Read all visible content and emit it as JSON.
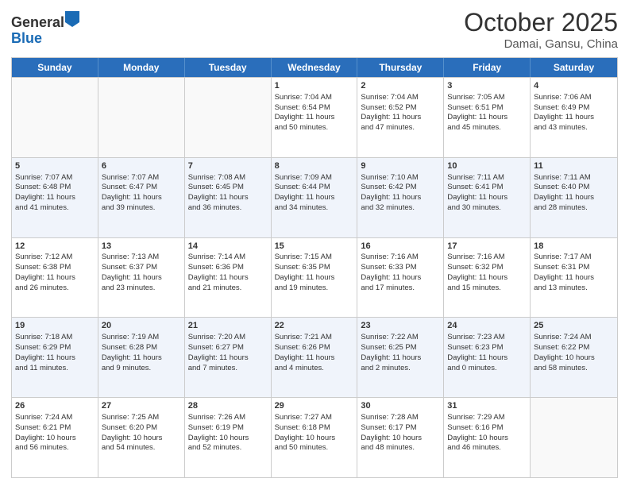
{
  "logo": {
    "general": "General",
    "blue": "Blue"
  },
  "title": "October 2025",
  "location": "Damai, Gansu, China",
  "days": [
    "Sunday",
    "Monday",
    "Tuesday",
    "Wednesday",
    "Thursday",
    "Friday",
    "Saturday"
  ],
  "weeks": [
    [
      {
        "day": "",
        "info": ""
      },
      {
        "day": "",
        "info": ""
      },
      {
        "day": "",
        "info": ""
      },
      {
        "day": "1",
        "info": "Sunrise: 7:04 AM\nSunset: 6:54 PM\nDaylight: 11 hours\nand 50 minutes."
      },
      {
        "day": "2",
        "info": "Sunrise: 7:04 AM\nSunset: 6:52 PM\nDaylight: 11 hours\nand 47 minutes."
      },
      {
        "day": "3",
        "info": "Sunrise: 7:05 AM\nSunset: 6:51 PM\nDaylight: 11 hours\nand 45 minutes."
      },
      {
        "day": "4",
        "info": "Sunrise: 7:06 AM\nSunset: 6:49 PM\nDaylight: 11 hours\nand 43 minutes."
      }
    ],
    [
      {
        "day": "5",
        "info": "Sunrise: 7:07 AM\nSunset: 6:48 PM\nDaylight: 11 hours\nand 41 minutes."
      },
      {
        "day": "6",
        "info": "Sunrise: 7:07 AM\nSunset: 6:47 PM\nDaylight: 11 hours\nand 39 minutes."
      },
      {
        "day": "7",
        "info": "Sunrise: 7:08 AM\nSunset: 6:45 PM\nDaylight: 11 hours\nand 36 minutes."
      },
      {
        "day": "8",
        "info": "Sunrise: 7:09 AM\nSunset: 6:44 PM\nDaylight: 11 hours\nand 34 minutes."
      },
      {
        "day": "9",
        "info": "Sunrise: 7:10 AM\nSunset: 6:42 PM\nDaylight: 11 hours\nand 32 minutes."
      },
      {
        "day": "10",
        "info": "Sunrise: 7:11 AM\nSunset: 6:41 PM\nDaylight: 11 hours\nand 30 minutes."
      },
      {
        "day": "11",
        "info": "Sunrise: 7:11 AM\nSunset: 6:40 PM\nDaylight: 11 hours\nand 28 minutes."
      }
    ],
    [
      {
        "day": "12",
        "info": "Sunrise: 7:12 AM\nSunset: 6:38 PM\nDaylight: 11 hours\nand 26 minutes."
      },
      {
        "day": "13",
        "info": "Sunrise: 7:13 AM\nSunset: 6:37 PM\nDaylight: 11 hours\nand 23 minutes."
      },
      {
        "day": "14",
        "info": "Sunrise: 7:14 AM\nSunset: 6:36 PM\nDaylight: 11 hours\nand 21 minutes."
      },
      {
        "day": "15",
        "info": "Sunrise: 7:15 AM\nSunset: 6:35 PM\nDaylight: 11 hours\nand 19 minutes."
      },
      {
        "day": "16",
        "info": "Sunrise: 7:16 AM\nSunset: 6:33 PM\nDaylight: 11 hours\nand 17 minutes."
      },
      {
        "day": "17",
        "info": "Sunrise: 7:16 AM\nSunset: 6:32 PM\nDaylight: 11 hours\nand 15 minutes."
      },
      {
        "day": "18",
        "info": "Sunrise: 7:17 AM\nSunset: 6:31 PM\nDaylight: 11 hours\nand 13 minutes."
      }
    ],
    [
      {
        "day": "19",
        "info": "Sunrise: 7:18 AM\nSunset: 6:29 PM\nDaylight: 11 hours\nand 11 minutes."
      },
      {
        "day": "20",
        "info": "Sunrise: 7:19 AM\nSunset: 6:28 PM\nDaylight: 11 hours\nand 9 minutes."
      },
      {
        "day": "21",
        "info": "Sunrise: 7:20 AM\nSunset: 6:27 PM\nDaylight: 11 hours\nand 7 minutes."
      },
      {
        "day": "22",
        "info": "Sunrise: 7:21 AM\nSunset: 6:26 PM\nDaylight: 11 hours\nand 4 minutes."
      },
      {
        "day": "23",
        "info": "Sunrise: 7:22 AM\nSunset: 6:25 PM\nDaylight: 11 hours\nand 2 minutes."
      },
      {
        "day": "24",
        "info": "Sunrise: 7:23 AM\nSunset: 6:23 PM\nDaylight: 11 hours\nand 0 minutes."
      },
      {
        "day": "25",
        "info": "Sunrise: 7:24 AM\nSunset: 6:22 PM\nDaylight: 10 hours\nand 58 minutes."
      }
    ],
    [
      {
        "day": "26",
        "info": "Sunrise: 7:24 AM\nSunset: 6:21 PM\nDaylight: 10 hours\nand 56 minutes."
      },
      {
        "day": "27",
        "info": "Sunrise: 7:25 AM\nSunset: 6:20 PM\nDaylight: 10 hours\nand 54 minutes."
      },
      {
        "day": "28",
        "info": "Sunrise: 7:26 AM\nSunset: 6:19 PM\nDaylight: 10 hours\nand 52 minutes."
      },
      {
        "day": "29",
        "info": "Sunrise: 7:27 AM\nSunset: 6:18 PM\nDaylight: 10 hours\nand 50 minutes."
      },
      {
        "day": "30",
        "info": "Sunrise: 7:28 AM\nSunset: 6:17 PM\nDaylight: 10 hours\nand 48 minutes."
      },
      {
        "day": "31",
        "info": "Sunrise: 7:29 AM\nSunset: 6:16 PM\nDaylight: 10 hours\nand 46 minutes."
      },
      {
        "day": "",
        "info": ""
      }
    ]
  ]
}
